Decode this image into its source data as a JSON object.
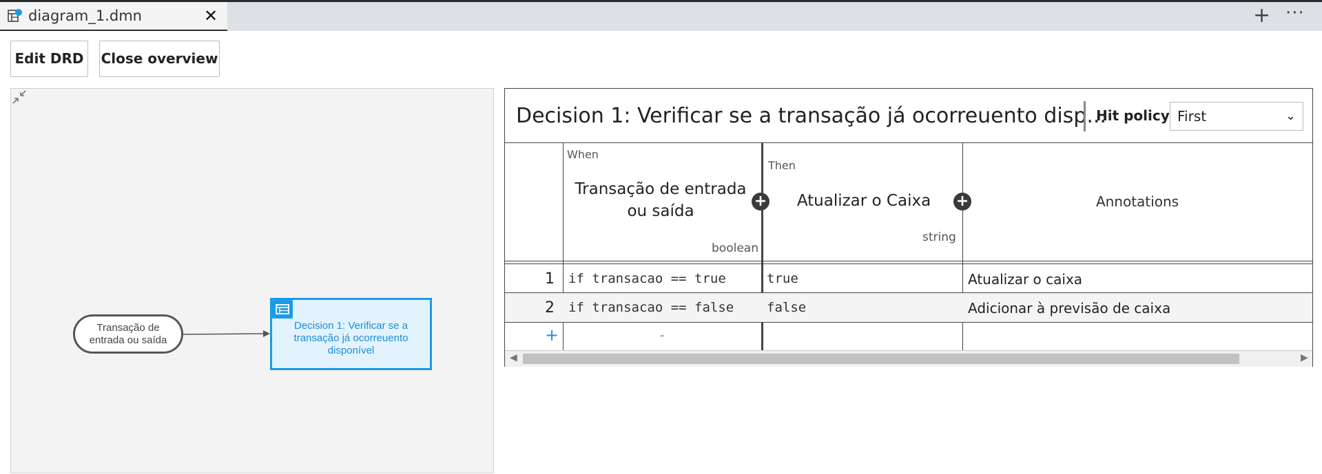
{
  "tab": {
    "filename": "diagram_1.dmn",
    "close": "✕"
  },
  "tabbar": {
    "new_tab": "+",
    "more": "···"
  },
  "buttons": {
    "edit_drd": "Edit DRD",
    "close_overview": "Close overview"
  },
  "drd": {
    "input_node": "Transação de entrada ou saída",
    "decision_node": "Decision 1: Verificar se a transação já ocorreuento disponível"
  },
  "decision_table": {
    "title": "Decision 1: Verificar se a transação já ocorreuento disp...",
    "hit_policy_label": "Hit policy:",
    "hit_policy_value": "First",
    "when_label": "When",
    "then_label": "Then",
    "input_column": {
      "label": "Transação de entrada ou saída",
      "type": "boolean"
    },
    "output_column": {
      "label": "Atualizar o Caixa",
      "type": "string"
    },
    "annotations_label": "Annotations",
    "add_column": "+",
    "rows": [
      {
        "num": "1",
        "input": "if transacao == true",
        "output": "true",
        "annotation": "Atualizar o caixa"
      },
      {
        "num": "2",
        "input": "if transacao == false",
        "output": "false",
        "annotation": "Adicionar à previsão de caixa"
      }
    ],
    "add_row": "+",
    "empty_cell": "-"
  },
  "colors": {
    "accent": "#1a9be6",
    "node_fill": "#e3f3fd"
  }
}
